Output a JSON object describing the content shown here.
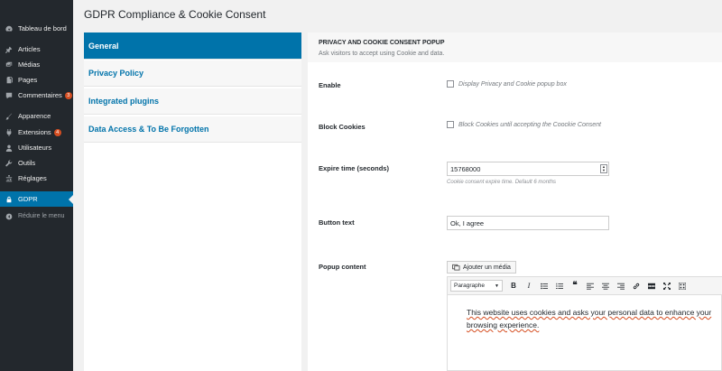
{
  "sidebar": {
    "items": [
      {
        "label": "Tableau de bord",
        "icon": "dashboard-icon"
      },
      {
        "label": "Articles",
        "icon": "pin-icon"
      },
      {
        "label": "Médias",
        "icon": "media-icon"
      },
      {
        "label": "Pages",
        "icon": "page-icon"
      },
      {
        "label": "Commentaires",
        "icon": "comment-icon",
        "count": "3"
      },
      {
        "label": "Apparence",
        "icon": "brush-icon"
      },
      {
        "label": "Extensions",
        "icon": "plugin-icon",
        "count": "4"
      },
      {
        "label": "Utilisateurs",
        "icon": "user-icon"
      },
      {
        "label": "Outils",
        "icon": "wrench-icon"
      },
      {
        "label": "Réglages",
        "icon": "settings-icon"
      },
      {
        "label": "GDPR",
        "icon": "lock-icon",
        "current": true
      },
      {
        "label": "Réduire le menu",
        "icon": "collapse-icon"
      }
    ]
  },
  "page": {
    "title": "GDPR Compliance & Cookie Consent"
  },
  "tabs": [
    {
      "label": "General",
      "active": true
    },
    {
      "label": "Privacy Policy"
    },
    {
      "label": "Integrated plugins"
    },
    {
      "label": "Data Access & To Be Forgotten"
    }
  ],
  "panel": {
    "title": "PRIVACY AND COOKIE CONSENT POPUP",
    "subtitle": "Ask visitors to accept using Cookie and data."
  },
  "fields": {
    "enable": {
      "label": "Enable",
      "checkbox_text": "Display Privacy and Cookie popup box",
      "checked": false
    },
    "block_cookies": {
      "label": "Block Cookies",
      "checkbox_text": "Block Cookies until accepting the Coockie Consent",
      "checked": false
    },
    "expire_time": {
      "label": "Expire time (seconds)",
      "value": "15768000",
      "hint": "Cookie consent expire time. Default 6 months"
    },
    "button_text": {
      "label": "Button text",
      "value": "Ok, I agree"
    },
    "popup_content": {
      "label": "Popup content",
      "add_media_label": "Ajouter un média",
      "format_value": "Paragraphe",
      "content": "This website uses cookies and asks your personal data to enhance your browsing experience."
    }
  },
  "colors": {
    "accent": "#0073aa",
    "sidebar_bg": "#23282d",
    "badge": "#d54e21"
  }
}
